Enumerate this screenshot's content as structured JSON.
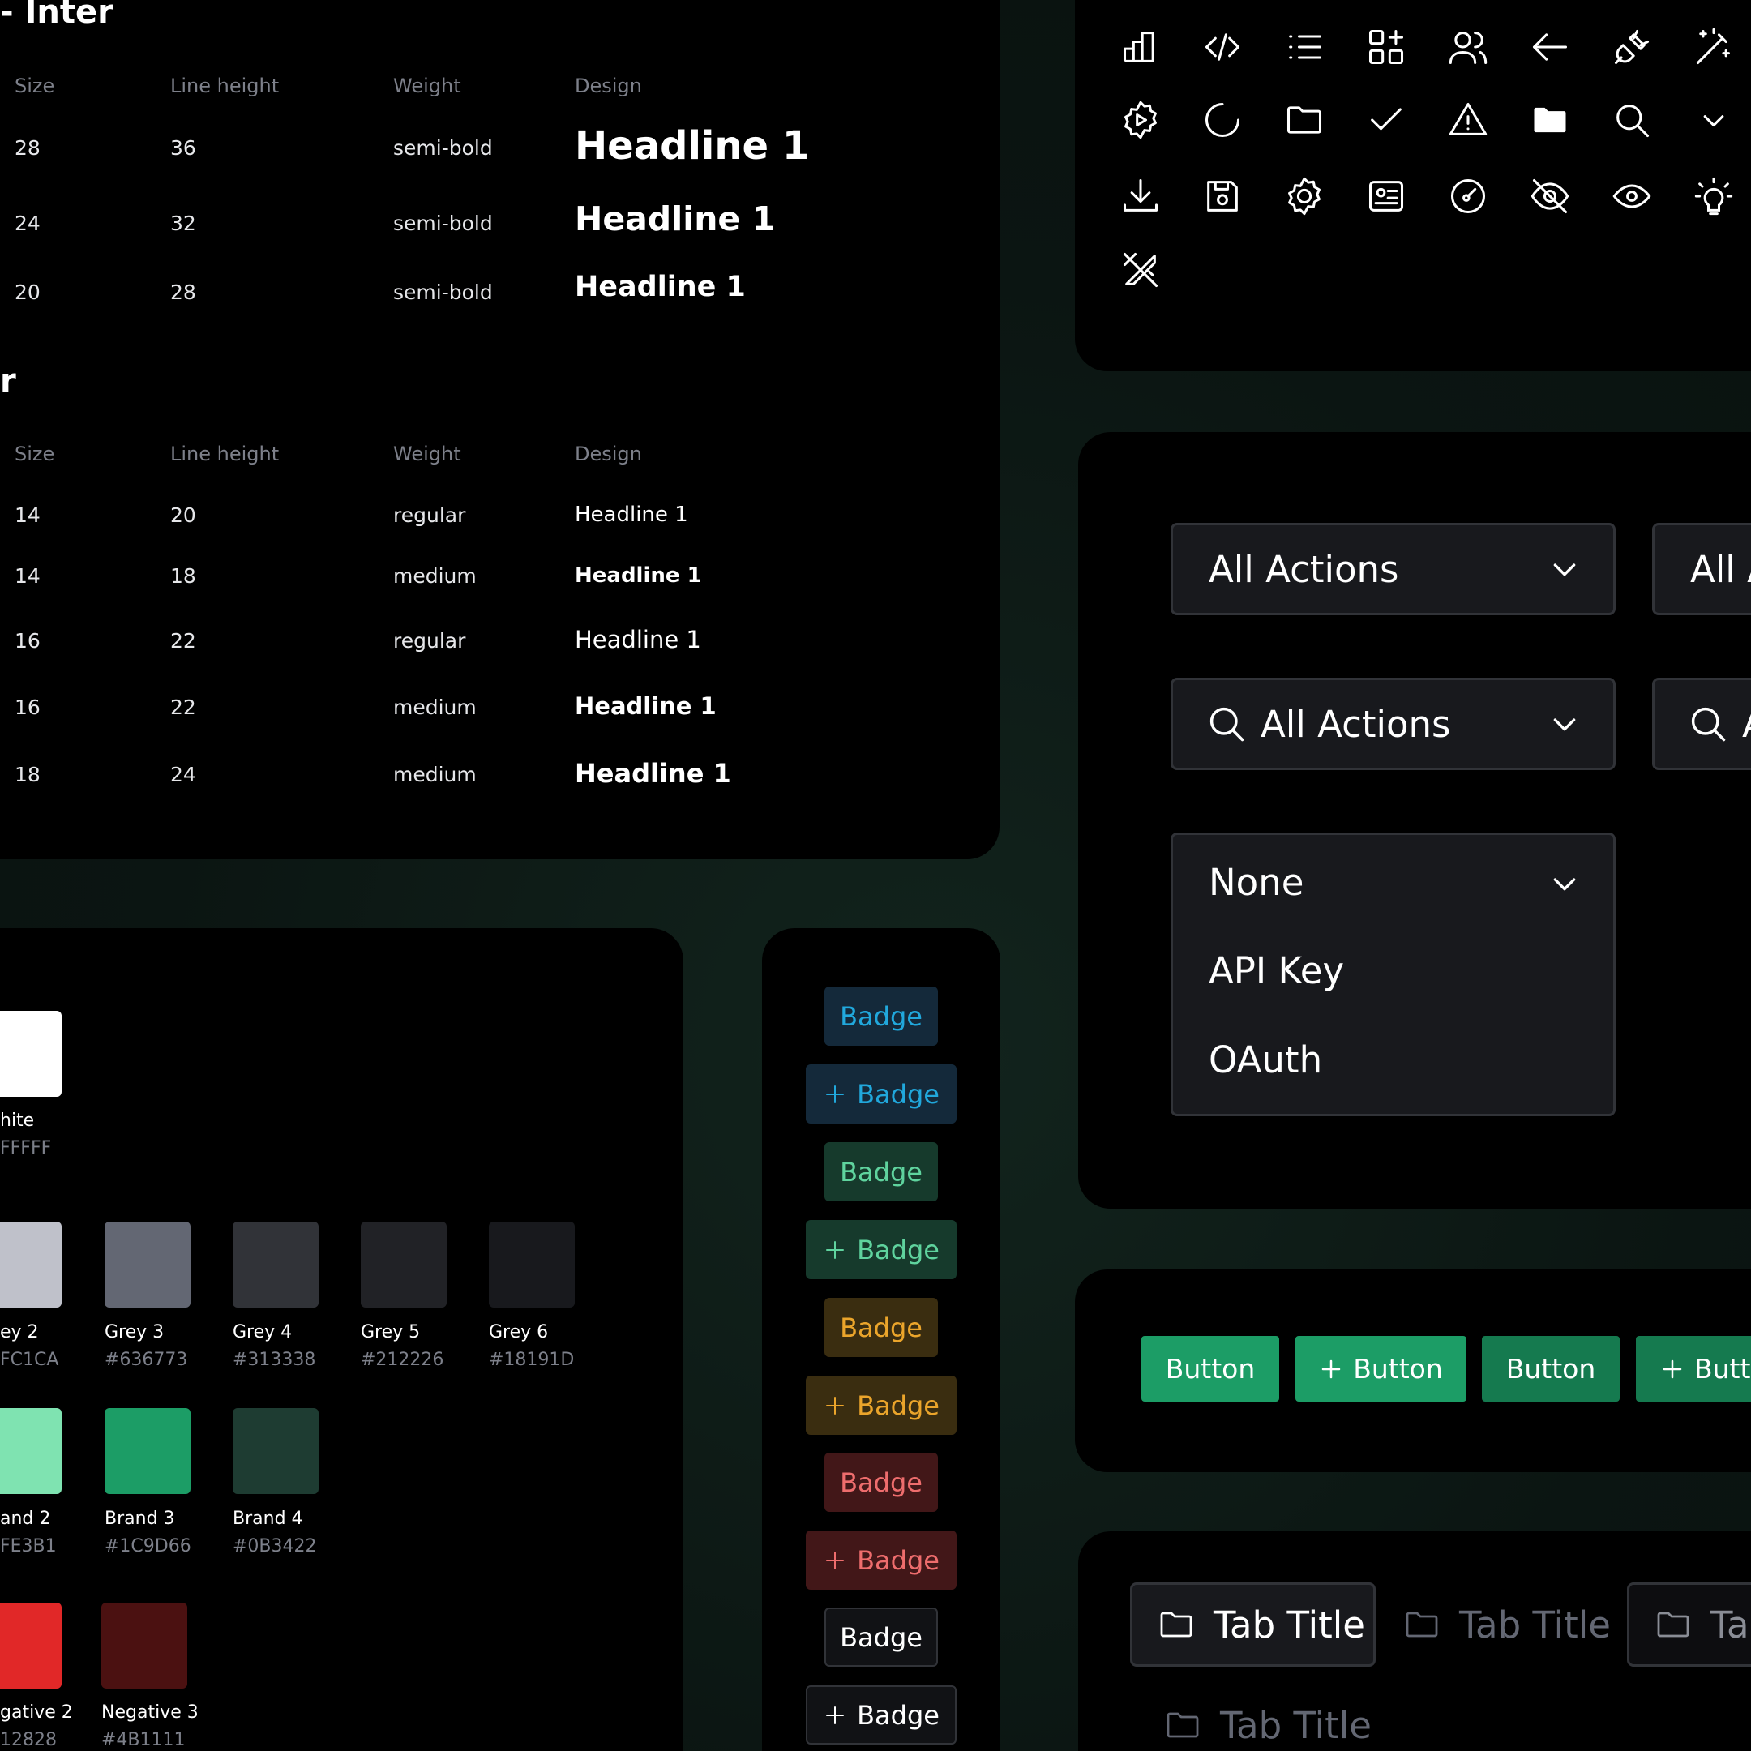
{
  "typography": {
    "headlines_title": "- Inter",
    "body_title": "r",
    "columns": {
      "size": "Size",
      "line_height": "Line height",
      "weight": "Weight",
      "design": "Design"
    },
    "headlines": [
      {
        "size": "28",
        "line_height": "36",
        "weight": "semi-bold",
        "sample": "Headline 1"
      },
      {
        "size": "24",
        "line_height": "32",
        "weight": "semi-bold",
        "sample": "Headline 1"
      },
      {
        "size": "20",
        "line_height": "28",
        "weight": "semi-bold",
        "sample": "Headline 1"
      }
    ],
    "body": [
      {
        "size": "14",
        "line_height": "20",
        "weight": "regular",
        "sample": "Headline 1"
      },
      {
        "size": "14",
        "line_height": "18",
        "weight": "medium",
        "sample": "Headline 1"
      },
      {
        "size": "16",
        "line_height": "22",
        "weight": "regular",
        "sample": "Headline 1"
      },
      {
        "size": "16",
        "line_height": "22",
        "weight": "medium",
        "sample": "Headline 1"
      },
      {
        "size": "18",
        "line_height": "24",
        "weight": "medium",
        "sample": "Headline 1"
      }
    ]
  },
  "icons": [
    "bar-chart-icon",
    "code-icon",
    "list-icon",
    "add-widget-icon",
    "users-icon",
    "arrow-left-icon",
    "plug-icon",
    "magic-wand-icon",
    "settings-play-icon",
    "loader-icon",
    "folder-icon",
    "check-icon",
    "warning-icon",
    "folder-filled-icon",
    "search-icon",
    "chevron-down-icon",
    "download-icon",
    "save-icon",
    "gear-icon",
    "id-card-icon",
    "gauge-icon",
    "eye-off-icon",
    "eye-icon",
    "lightbulb-icon",
    "design-tools-icon"
  ],
  "selects": {
    "dropdown1": "All Actions",
    "dropdown1_partial": "All A",
    "search_dropdown": "All Actions",
    "search_dropdown_partial": "A",
    "open_dropdown": {
      "selected": "None",
      "options": [
        "API Key",
        "OAuth"
      ]
    }
  },
  "buttons": {
    "labels": [
      "Button",
      "Button",
      "Button",
      "Butto"
    ]
  },
  "tabs": {
    "labels": [
      "Tab Title",
      "Tab Title",
      "Tab",
      "Tab Title"
    ]
  },
  "colors": {
    "swatches": [
      {
        "name": "hite",
        "hex": "FFFFF",
        "color": "#FFFFFF"
      },
      {
        "name": "ey 2",
        "hex": "FC1CA",
        "color": "#BFC1CA"
      },
      {
        "name": "Grey 3",
        "hex": "#636773",
        "color": "#636773"
      },
      {
        "name": "Grey 4",
        "hex": "#313338",
        "color": "#313338"
      },
      {
        "name": "Grey 5",
        "hex": "#212226",
        "color": "#212226"
      },
      {
        "name": "Grey 6",
        "hex": "#18191D",
        "color": "#18191D"
      },
      {
        "name": "and 2",
        "hex": "FE3B1",
        "color": "#7FE3B1"
      },
      {
        "name": "Brand 3",
        "hex": "#1C9D66",
        "color": "#1C9D66"
      },
      {
        "name": "Brand 4",
        "hex": "#0B3422",
        "color": "#1E3C32"
      },
      {
        "name": "gative 2",
        "hex": "12828",
        "color": "#E12828"
      },
      {
        "name": "Negative 3",
        "hex": "#4B1111",
        "color": "#4B1111"
      }
    ]
  },
  "badges": {
    "labels": [
      "Badge",
      "Badge",
      "Badge",
      "Badge",
      "Badge",
      "Badge",
      "Badge",
      "Badge",
      "Badge",
      "Badge"
    ],
    "accent_colors": [
      "#21A8DC",
      "#5FD39E",
      "#EBA52B",
      "#EE6D6D",
      "#FFFFFF"
    ]
  },
  "theme": {
    "brand_button": "#1C9D66",
    "brand_button_dark": "#157A4F"
  }
}
